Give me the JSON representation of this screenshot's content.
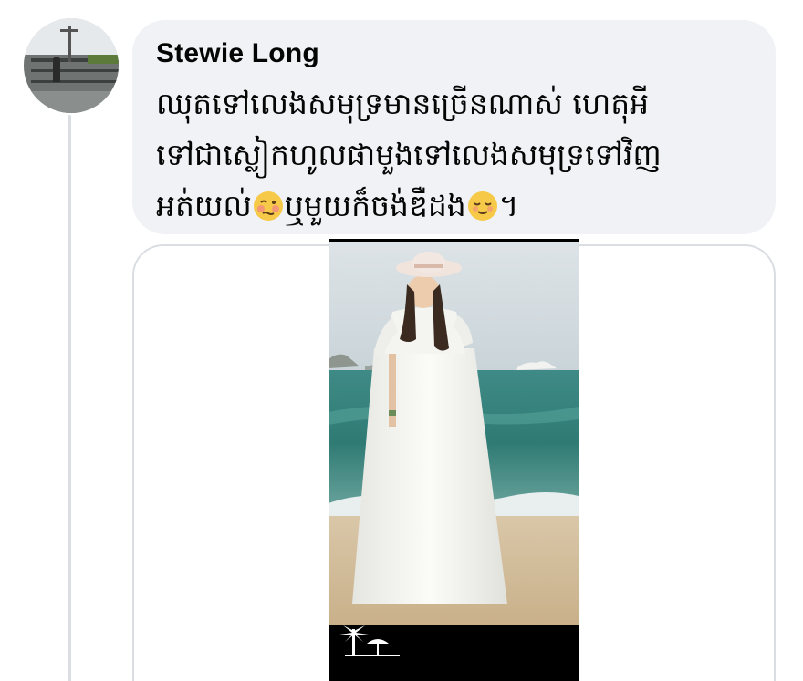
{
  "comment": {
    "author": "Stewie Long",
    "text_line1": "ឈុតទៅលេងសមុទ្រមានច្រើនណាស់ ហេតុអី",
    "text_line2": "ទៅជាស្លៀកហូលផាមួងទៅលេងសមុទ្រទៅវិញ",
    "text_line3_part1": "អត់យល់",
    "emoji1": "woozy-face",
    "text_line3_part2": "ឬមួយក៏ចង់ឌឺដង",
    "emoji2": "relieved-face",
    "text_line3_part3": "។"
  },
  "colors": {
    "bubble_bg": "#f0f2f5",
    "text": "#050505",
    "border": "#dadde1"
  }
}
